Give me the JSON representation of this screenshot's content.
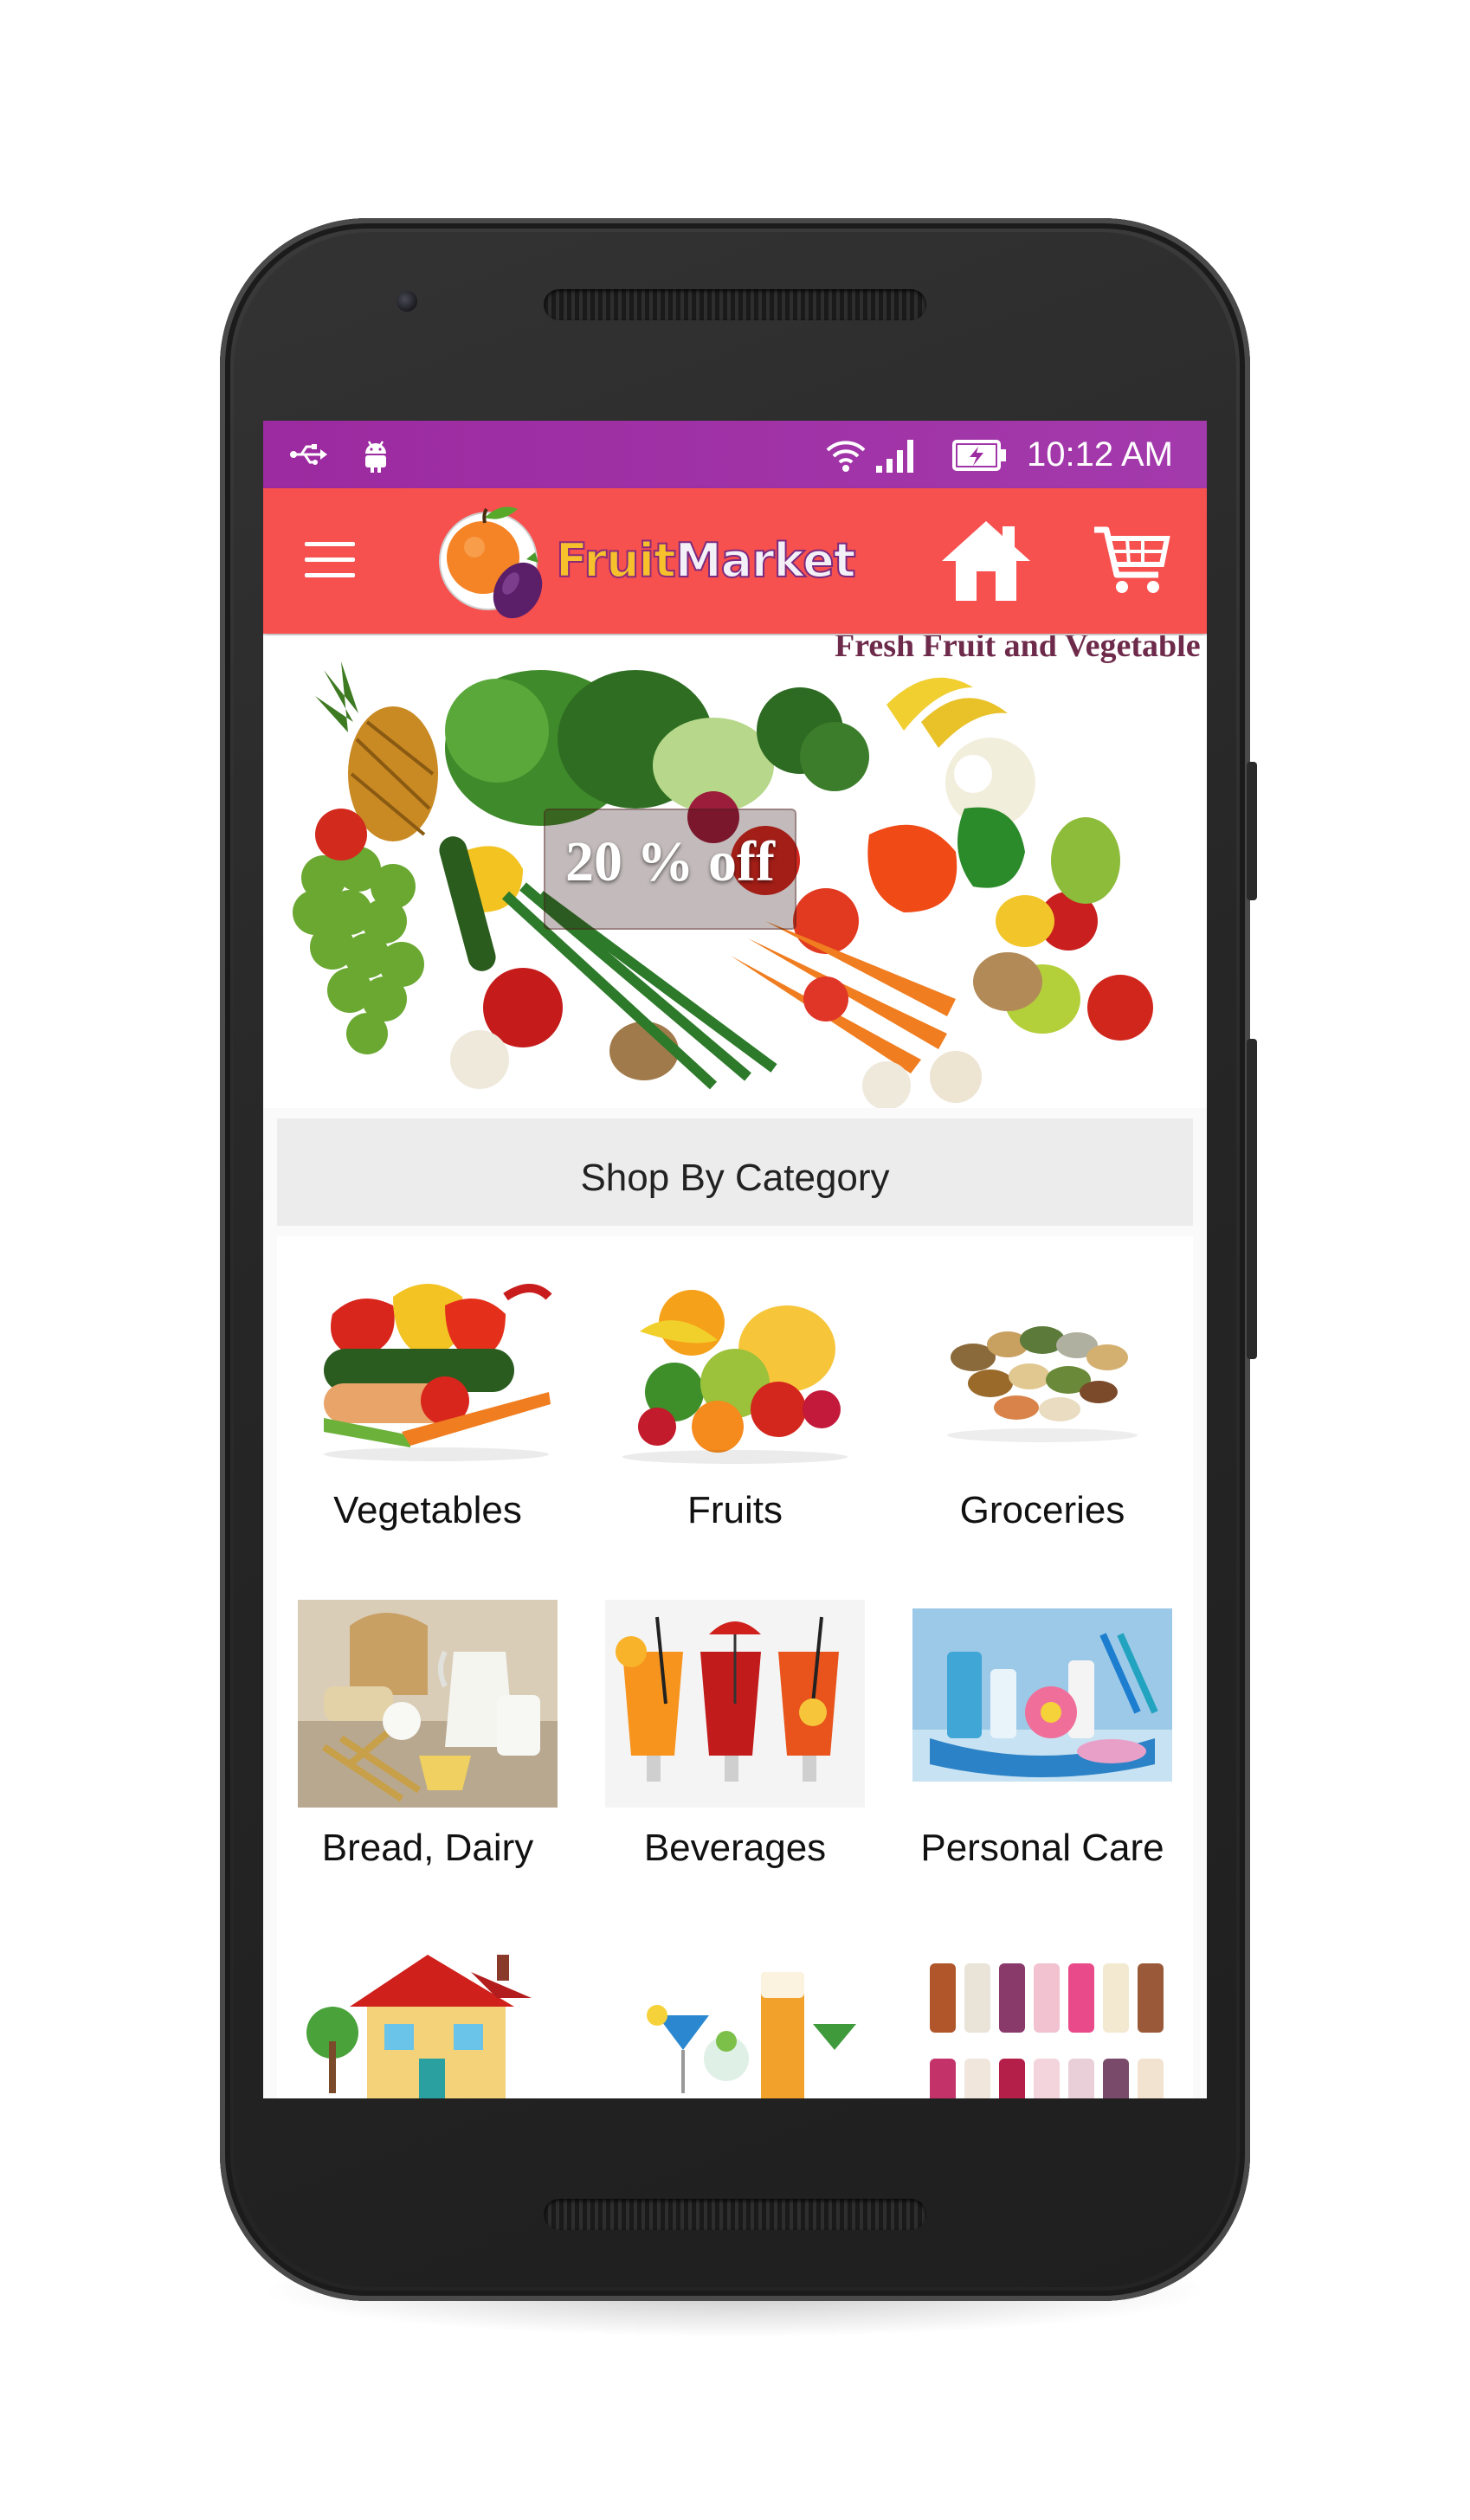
{
  "status_bar": {
    "time": "10:12 AM",
    "icons": [
      "usb-icon",
      "android-debug-icon",
      "wifi-icon",
      "signal-icon",
      "battery-charging-icon"
    ]
  },
  "app_bar": {
    "menu_icon": "hamburger-menu-icon",
    "logo_text_1": "Fruit",
    "logo_text_2": "Market",
    "home_icon": "home-icon",
    "cart_icon": "shopping-cart-icon",
    "color": "#f6504f"
  },
  "banner": {
    "tagline": "Fresh Fruit and Vegetable",
    "promo": "20 % off"
  },
  "category": {
    "title": "Shop By Category",
    "items": [
      {
        "label": "Vegetables"
      },
      {
        "label": "Fruits"
      },
      {
        "label": "Groceries"
      },
      {
        "label": "Bread, Dairy"
      },
      {
        "label": "Beverages"
      },
      {
        "label": "Personal Care"
      }
    ]
  },
  "colors": {
    "status_bar": "#9c2aa0",
    "accent": "#f6504f"
  }
}
